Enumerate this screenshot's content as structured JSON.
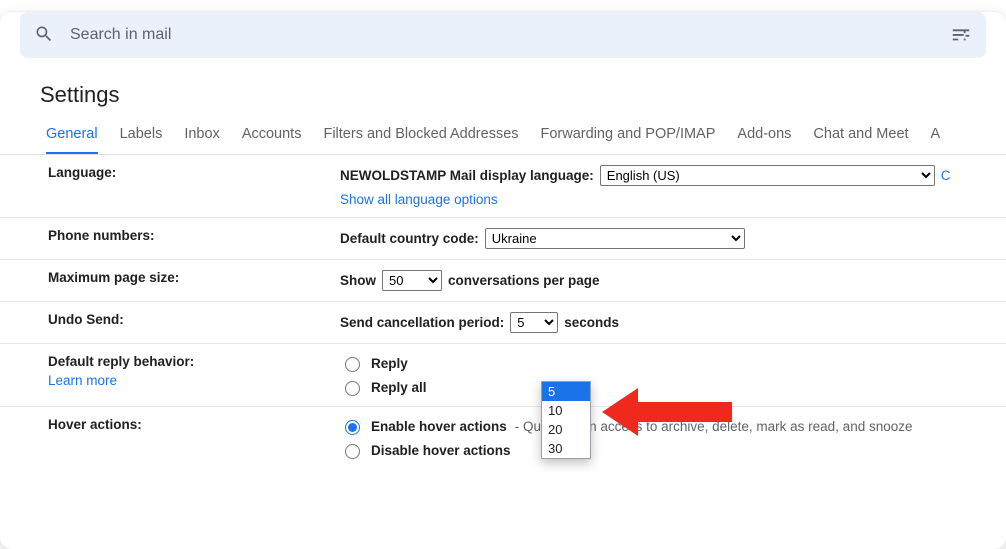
{
  "search": {
    "placeholder": "Search in mail"
  },
  "page_title": "Settings",
  "tabs": [
    "General",
    "Labels",
    "Inbox",
    "Accounts",
    "Filters and Blocked Addresses",
    "Forwarding and POP/IMAP",
    "Add-ons",
    "Chat and Meet",
    "A"
  ],
  "active_tab_index": 0,
  "language": {
    "label": "Language:",
    "display_lang_label": "NEWOLDSTAMP Mail display language:",
    "value": "English (US)",
    "show_all": "Show all language options"
  },
  "phone": {
    "label": "Phone numbers:",
    "code_label": "Default country code:",
    "value": "Ukraine"
  },
  "page_size": {
    "label": "Maximum page size:",
    "prefix": "Show",
    "value": "50",
    "suffix": "conversations per page"
  },
  "undo_send": {
    "label": "Undo Send:",
    "period_label": "Send cancellation period:",
    "value": "5",
    "suffix": "seconds",
    "options": [
      "5",
      "10",
      "20",
      "30"
    ]
  },
  "reply": {
    "label": "Default reply behavior:",
    "learn_more": "Learn more",
    "opt1": "Reply",
    "opt2": "Reply all",
    "selected": 0
  },
  "hover": {
    "label": "Hover actions:",
    "opt1": "Enable hover actions",
    "opt1_desc": " - Quickly gain access to archive, delete, mark as read, and snooze",
    "opt2": "Disable hover actions",
    "selected": 0
  }
}
